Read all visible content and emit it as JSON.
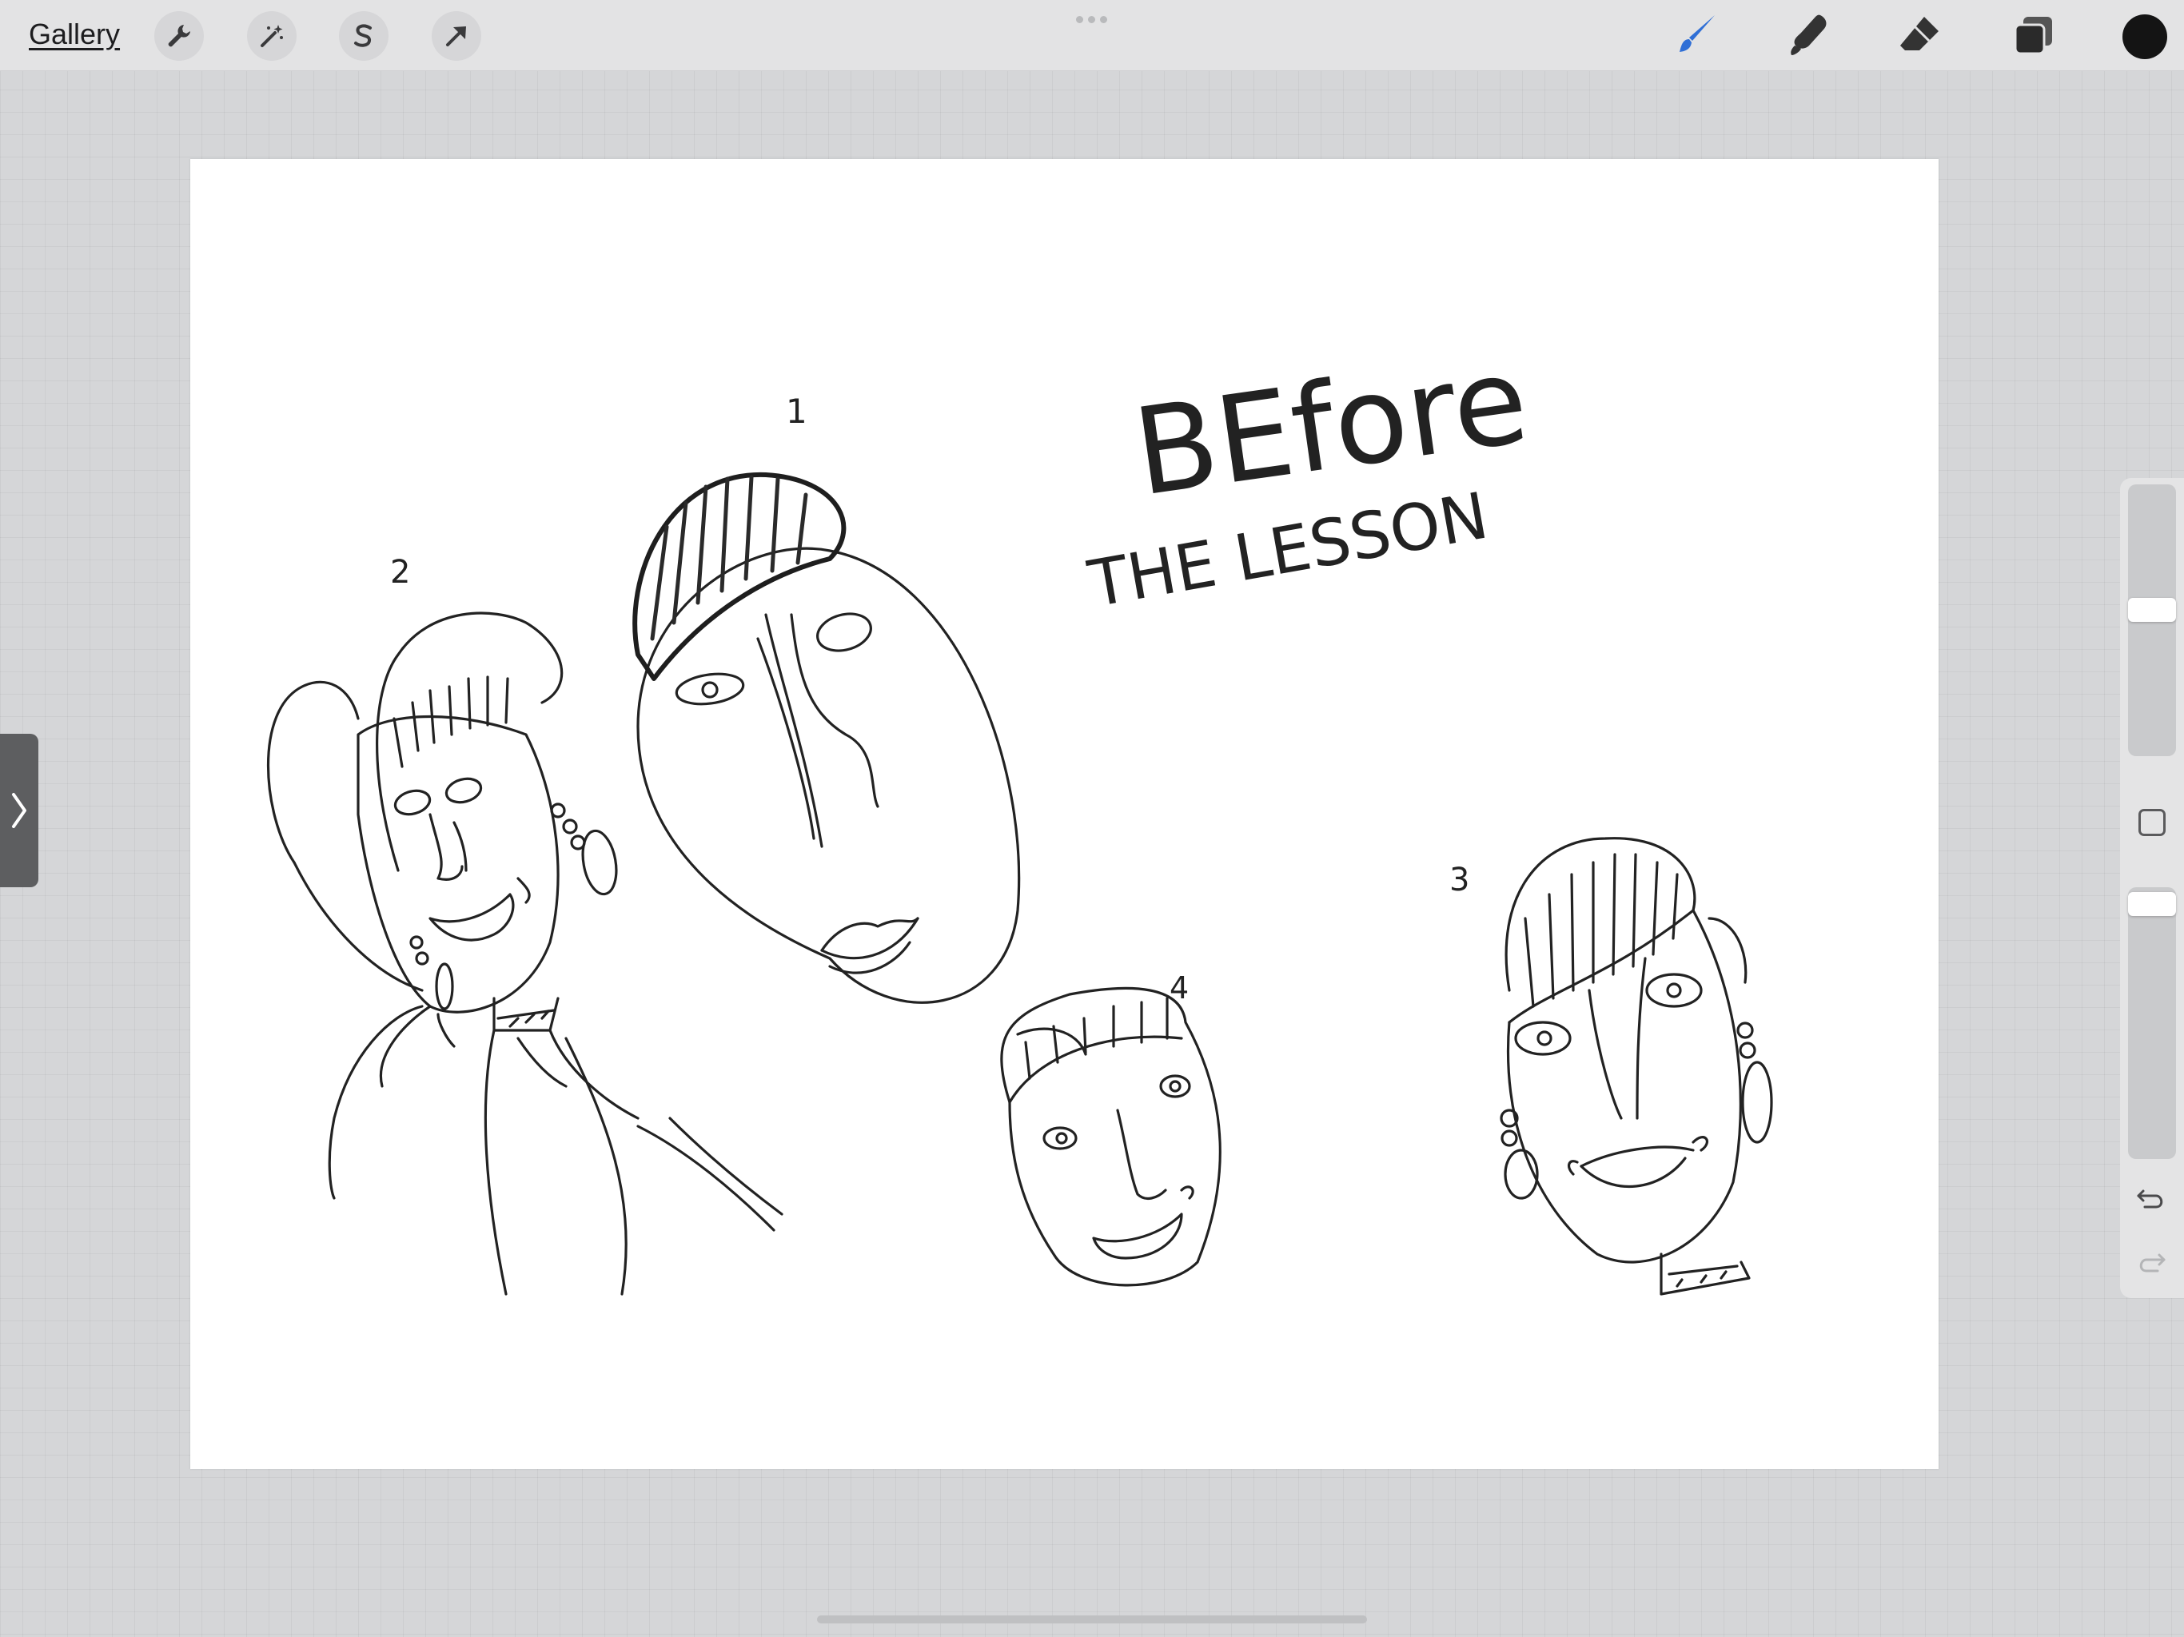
{
  "toolbar": {
    "gallery_label": "Gallery",
    "left_tools": [
      "actions-wrench",
      "adjustments-wand",
      "selection-s",
      "transform-arrow"
    ],
    "right_tools": [
      "brush",
      "smudge",
      "eraser",
      "layers"
    ],
    "active_tool": "brush",
    "active_color": "#141414",
    "accent": "#2f6fd6"
  },
  "sidebar": {
    "brush_size_level": 0.47,
    "opacity_level": 0.06
  },
  "artwork": {
    "title_line1": "BEfore",
    "title_line2": "THE LESSON",
    "face_numbers": [
      "1",
      "2",
      "3",
      "4"
    ]
  }
}
